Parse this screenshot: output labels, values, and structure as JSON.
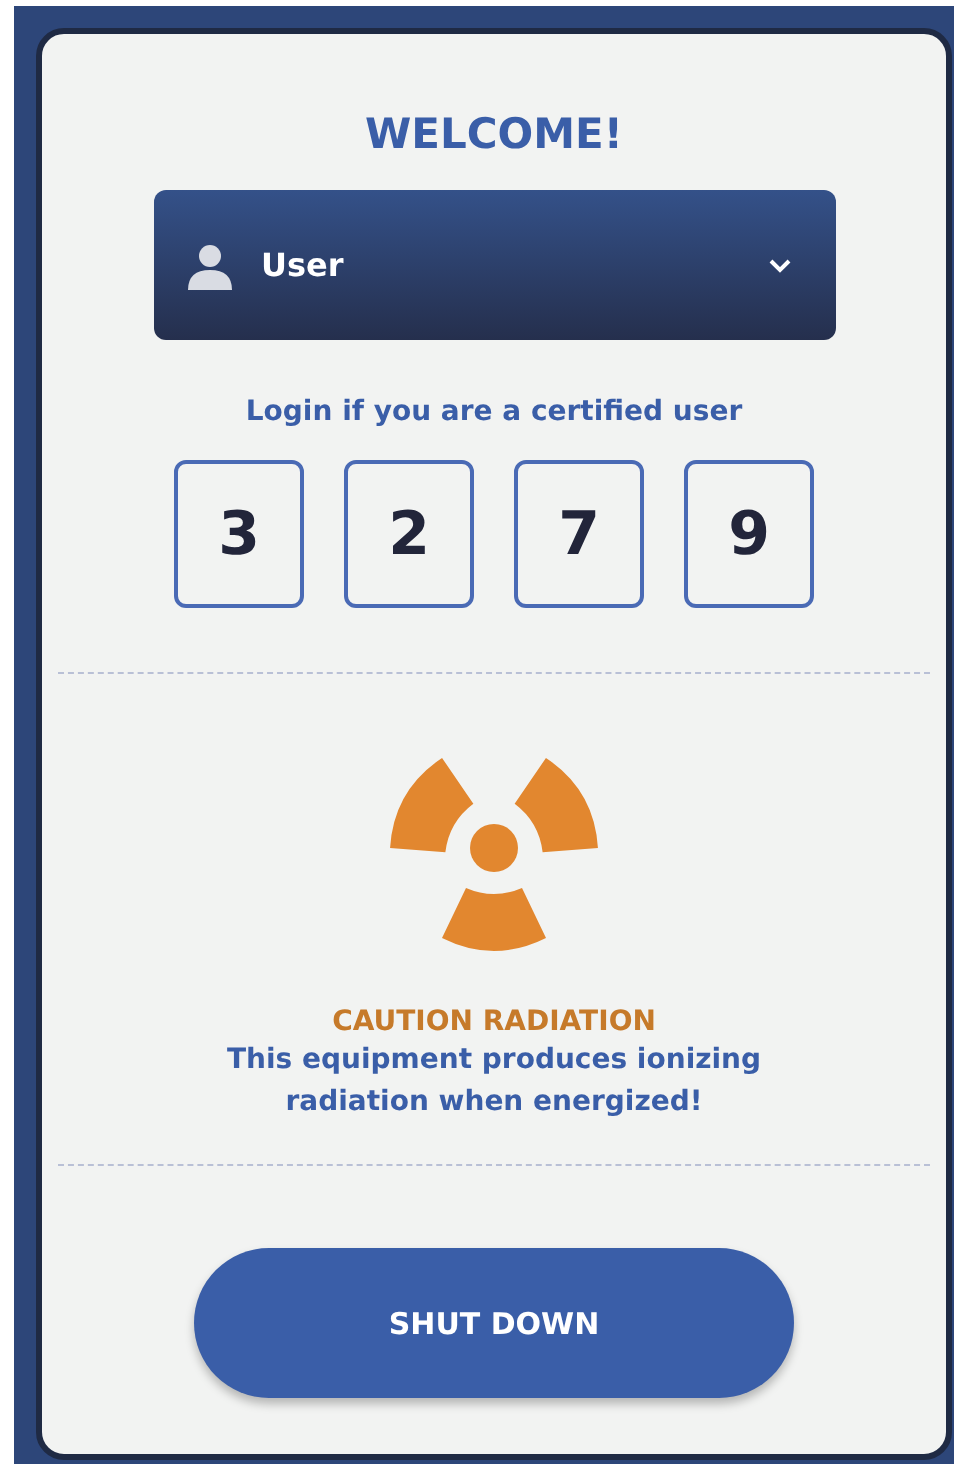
{
  "title": "WELCOME!",
  "user_select": {
    "value": "User"
  },
  "login_hint": "Login if you are a certified user",
  "code_digits": [
    "3",
    "2",
    "7",
    "9"
  ],
  "warning": {
    "title": "CAUTION RADIATION",
    "message": "This equipment produces ionizing radiation when energized!"
  },
  "shutdown_button": "SHUT DOWN"
}
